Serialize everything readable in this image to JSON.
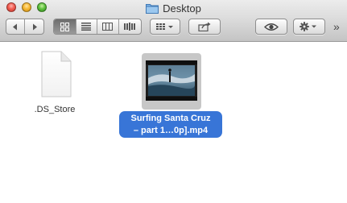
{
  "window": {
    "title": "Desktop"
  },
  "toolbar": {
    "back_icon": "back-arrow-icon",
    "forward_icon": "forward-arrow-icon",
    "views": [
      "icon-view-icon",
      "list-view-icon",
      "column-view-icon",
      "coverflow-view-icon"
    ],
    "active_view": "icon-view-icon",
    "arrange_icon": "arrange-grid-icon",
    "share_icon": "share-icon",
    "quicklook_icon": "eye-icon",
    "action_icon": "gear-icon",
    "overflow": "»"
  },
  "files": [
    {
      "name": ".DS_Store",
      "kind": "document"
    },
    {
      "name_line1": "Surfing Santa Cruz",
      "name_line2": "– part 1…0p].mp4",
      "kind": "video",
      "selected": true
    }
  ],
  "colors": {
    "selection": "#3875d7"
  }
}
